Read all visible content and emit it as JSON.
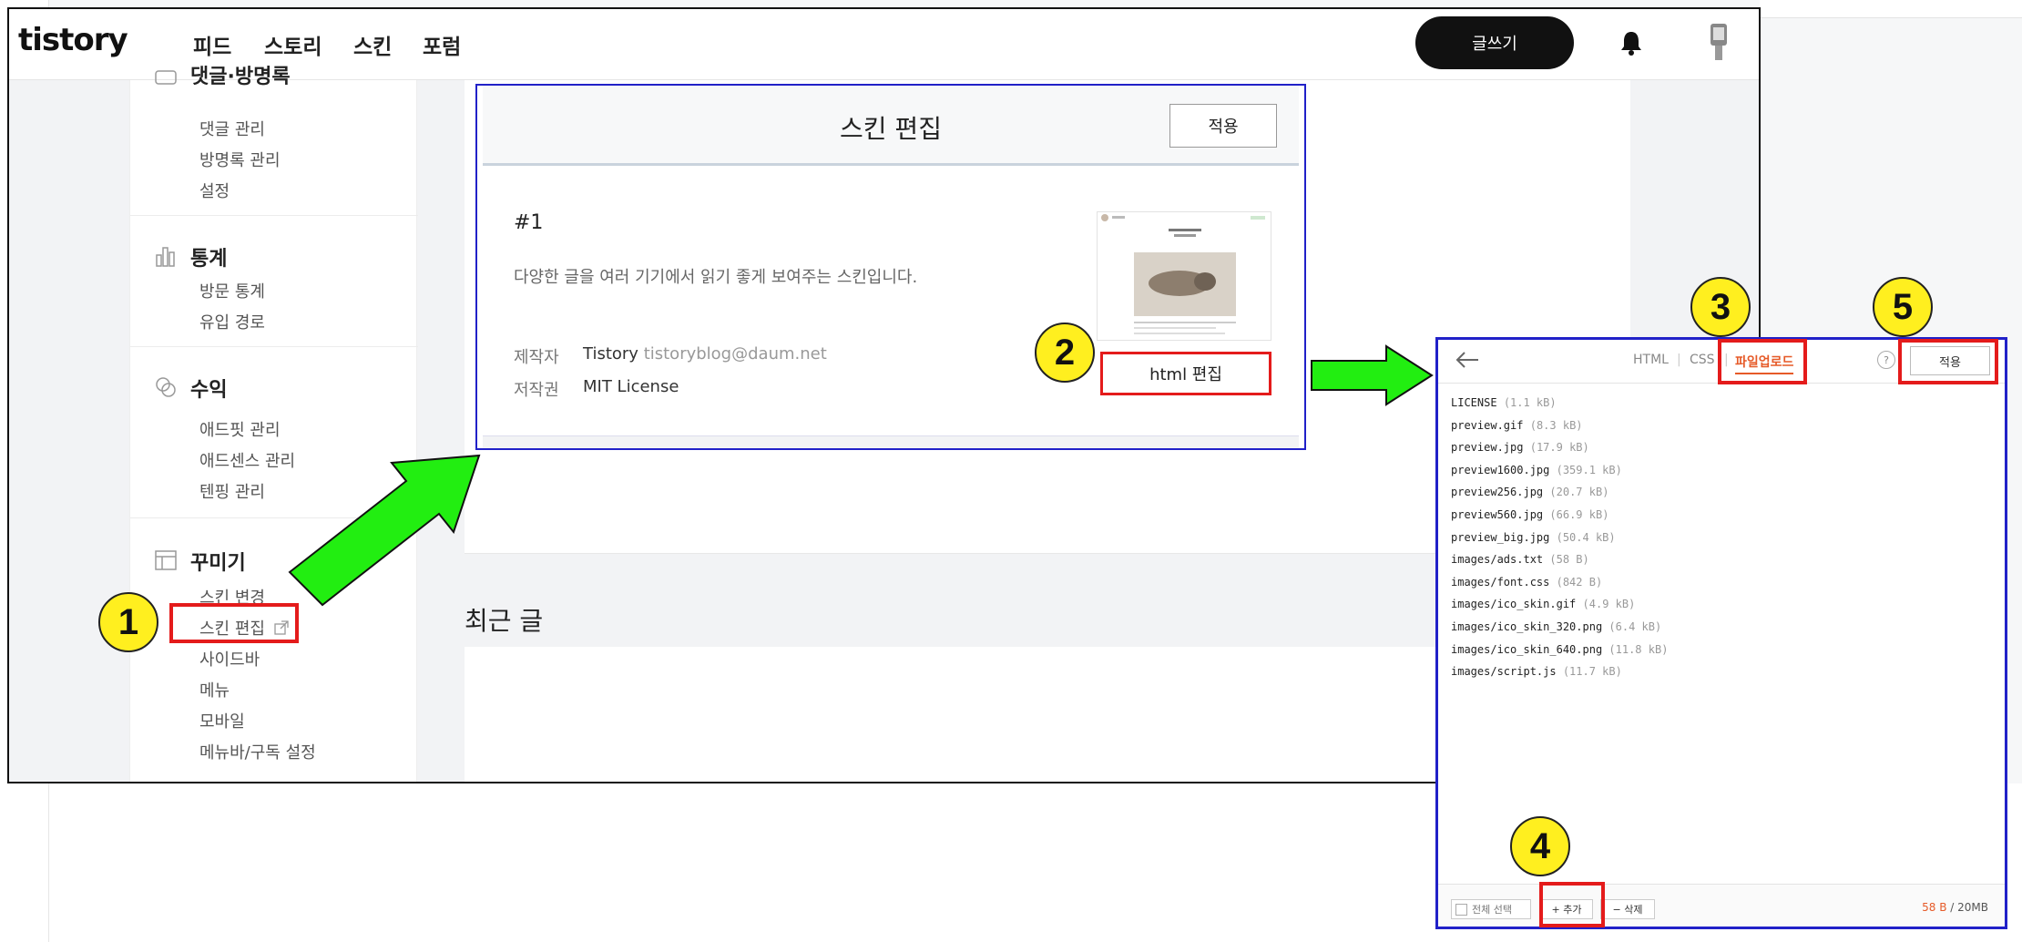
{
  "app": {
    "logo": "tistory",
    "nav": [
      "피드",
      "스토리",
      "스킨",
      "포럼"
    ],
    "write_button": "글쓰기"
  },
  "sidebar": {
    "top_partial": "댓글·방명록",
    "top_items": [
      "댓글 관리",
      "방명록 관리",
      "설정"
    ],
    "stats": {
      "title": "통계",
      "items": [
        "방문 통계",
        "유입 경로"
      ]
    },
    "revenue": {
      "title": "수익",
      "items": [
        "애드핏 관리",
        "애드센스 관리",
        "텐핑 관리"
      ]
    },
    "decorate": {
      "title": "꾸미기",
      "items": [
        "스킨 변경",
        "스킨 편집",
        "사이드바",
        "메뉴",
        "모바일",
        "메뉴바/구독 설정"
      ]
    }
  },
  "main": {
    "recent_title": "최근 글"
  },
  "skin_dialog": {
    "title": "스킨 편집",
    "apply": "적용",
    "skin_number": "#1",
    "description": "다양한 글을 여러 기기에서 읽기 좋게 보여주는 스킨입니다.",
    "author_label": "제작자",
    "author_name": "Tistory",
    "author_email": "tistoryblog@daum.net",
    "license_label": "저작권",
    "license_value": "MIT License",
    "html_edit_button": "html 편집"
  },
  "file_panel": {
    "tabs": [
      "HTML",
      "CSS",
      "파일업로드"
    ],
    "active_tab": "파일업로드",
    "help": "?",
    "apply": "적용",
    "files": [
      {
        "name": "LICENSE",
        "size": "(1.1 kB)"
      },
      {
        "name": "preview.gif",
        "size": "(8.3 kB)"
      },
      {
        "name": "preview.jpg",
        "size": "(17.9 kB)"
      },
      {
        "name": "preview1600.jpg",
        "size": "(359.1 kB)"
      },
      {
        "name": "preview256.jpg",
        "size": "(20.7 kB)"
      },
      {
        "name": "preview560.jpg",
        "size": "(66.9 kB)"
      },
      {
        "name": "preview_big.jpg",
        "size": "(50.4 kB)"
      },
      {
        "name": "images/ads.txt",
        "size": "(58 B)"
      },
      {
        "name": "images/font.css",
        "size": "(842 B)"
      },
      {
        "name": "images/ico_skin.gif",
        "size": "(4.9 kB)"
      },
      {
        "name": "images/ico_skin_320.png",
        "size": "(6.4 kB)"
      },
      {
        "name": "images/ico_skin_640.png",
        "size": "(11.8 kB)"
      },
      {
        "name": "images/script.js",
        "size": "(11.7 kB)"
      }
    ],
    "select_all": "전체 선택",
    "add_button": "+ 추가",
    "delete_button": "− 삭제",
    "quota_used": "58 B",
    "quota_total": "/ 20MB"
  },
  "badges": [
    "1",
    "2",
    "3",
    "4",
    "5"
  ],
  "colors": {
    "highlight": "#e41b1b",
    "dialog_border": "#2121c8",
    "arrow": "#22ee11",
    "badge": "#ffef1f",
    "accent": "#e65a28"
  }
}
